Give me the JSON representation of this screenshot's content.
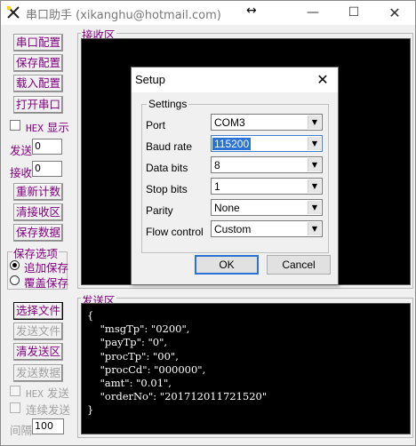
{
  "window": {
    "title": "串口助手 (xikanghu@hotmail.com)",
    "move_glyph": "↔",
    "minimize": "—",
    "maximize": "☐",
    "close": "✕"
  },
  "left": {
    "buttons": {
      "port_config": "串口配置",
      "save_config": "保存配置",
      "load_config": "载入配置",
      "open_port": "打开串口",
      "reset_count": "重新计数",
      "clear_recv": "清接收区",
      "save_data": "保存数据",
      "select_file": "选择文件",
      "send_file": "发送文件",
      "clear_send": "清发送区",
      "send_data": "发送数据"
    },
    "hex_show_prefix": "HEX",
    "hex_show_label": "显示",
    "send_count_label": "发送",
    "send_count": "0",
    "recv_count_label": "接收",
    "recv_count": "0",
    "save_options_title": "保存选项",
    "append_save": "追加保存",
    "overwrite_save": "覆盖保存",
    "hex_send_prefix": "HEX",
    "hex_send_label": "发送",
    "continuous_send": "连续发送",
    "interval_label": "间隔",
    "interval_value": "100"
  },
  "recv": {
    "title": "接收区"
  },
  "send": {
    "title": "发送区",
    "lines": [
      "{",
      "    \"msgTp\": \"0200\",",
      "    \"payTp\": \"0\",",
      "    \"procTp\": \"00\",",
      "    \"procCd\": \"000000\",",
      "    \"amt\": \"0.01\",",
      "    \"orderNo\": \"201712011721520\"",
      "}"
    ]
  },
  "dialog": {
    "title": "Setup",
    "close": "✕",
    "group_title": "Settings",
    "fields": [
      {
        "label": "Port",
        "value": "COM3"
      },
      {
        "label": "Baud rate",
        "value": "115200"
      },
      {
        "label": "Data bits",
        "value": "8"
      },
      {
        "label": "Stop bits",
        "value": "1"
      },
      {
        "label": "Parity",
        "value": "None"
      },
      {
        "label": "Flow control",
        "value": "Custom"
      }
    ],
    "ok": "OK",
    "cancel": "Cancel"
  },
  "colors": {
    "accent_text": "#800080",
    "area_bg": "#000000",
    "selection": "#2a72d6"
  },
  "icons": {
    "app": "serial-assistant-icon",
    "combo_arrow": "chevron-down-icon"
  }
}
